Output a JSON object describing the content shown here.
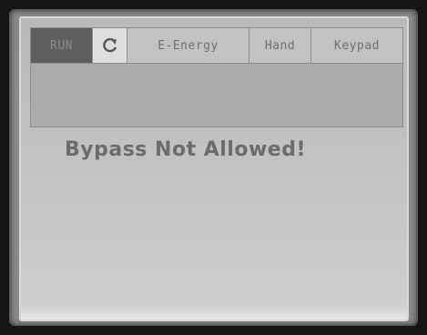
{
  "status_bar": {
    "run_state": "RUN",
    "refresh_icon": "refresh-icon",
    "energy_mode": "E-Energy",
    "control_mode": "Hand",
    "reference_source": "Keypad"
  },
  "message": {
    "text": "Bypass Not Allowed!"
  },
  "colors": {
    "screen_bg": "#c4c4c4",
    "state_cell_bg": "#5e5e5e",
    "text": "#6c6c6c"
  }
}
